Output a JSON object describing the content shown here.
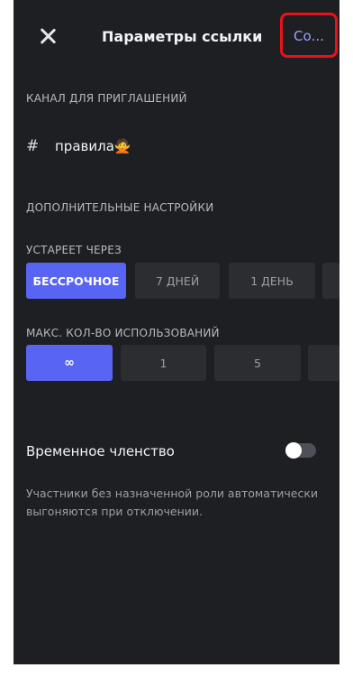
{
  "header": {
    "title": "Параметры ссылки",
    "save_label": "Со..."
  },
  "invite_channel": {
    "section_label": "КАНАЛ ДЛЯ ПРИГЛАШЕНИЙ",
    "hash_symbol": "#",
    "channel_name": "правила",
    "channel_emoji": "🙅"
  },
  "advanced": {
    "section_label": "ДОПОЛНИТЕЛЬНЫЕ НАСТРОЙКИ"
  },
  "expires": {
    "label": "УСТАРЕЕТ ЧЕРЕЗ",
    "options": [
      "БЕССРОЧНОЕ",
      "7 ДНЕЙ",
      "1 ДЕНЬ"
    ],
    "selected": "БЕССРОЧНОЕ"
  },
  "max_uses": {
    "label": "МАКС. КОЛ-ВО ИСПОЛЬЗОВАНИЙ",
    "options": [
      "∞",
      "1",
      "5"
    ],
    "selected": "∞"
  },
  "temporary_membership": {
    "label": "Временное членство",
    "enabled": false,
    "description": "Участники без назначенной роли автоматически выгоняются при отключении."
  },
  "colors": {
    "background": "#1e1f23",
    "accent": "#5865f2",
    "highlight_border": "#e8121d",
    "option_bg": "#2b2d31"
  },
  "icons": {
    "close": "close-icon",
    "toggle": "toggle-switch"
  }
}
